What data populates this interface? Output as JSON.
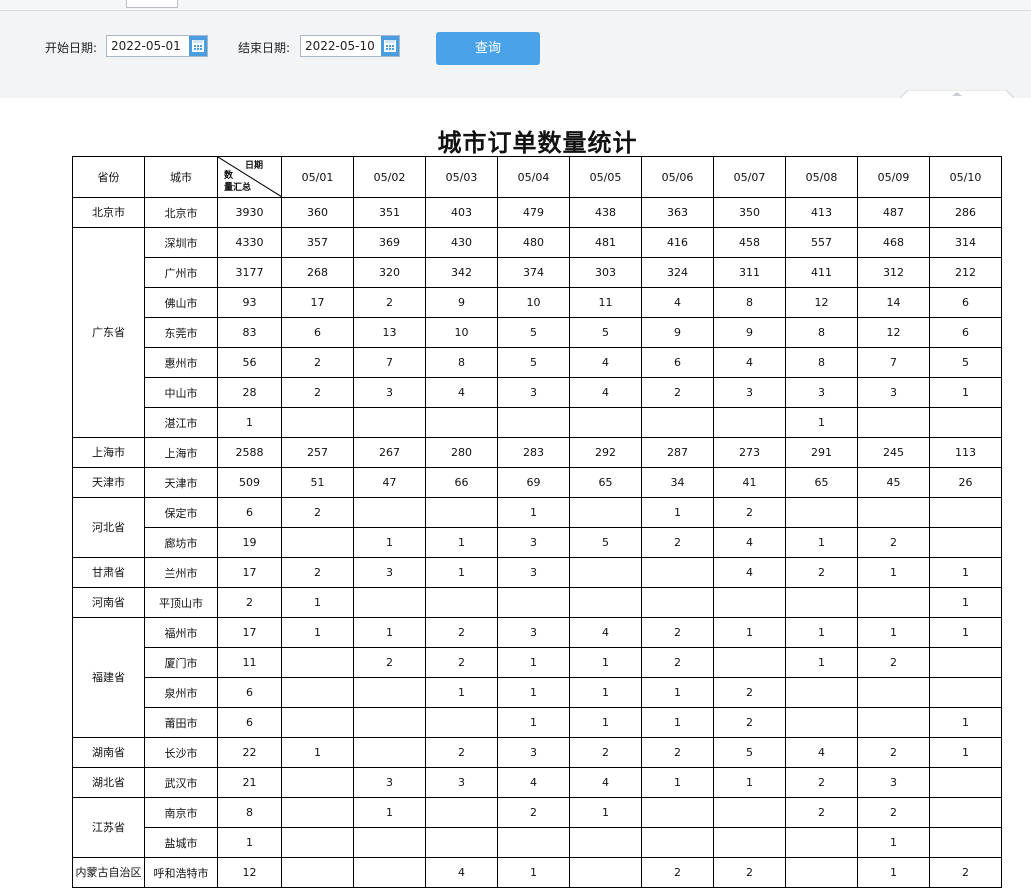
{
  "filters": {
    "start_label": "开始日期:",
    "start_value": "2022-05-01",
    "end_label": "结束日期:",
    "end_value": "2022-05-10",
    "query_label": "查询"
  },
  "report": {
    "title": "城市订单数量统计",
    "headers": {
      "province": "省份",
      "city": "城市",
      "diag_top": "日期",
      "diag_bottom": "数\n量汇总",
      "dates": [
        "05/01",
        "05/02",
        "05/03",
        "05/04",
        "05/05",
        "05/06",
        "05/07",
        "05/08",
        "05/09",
        "05/10"
      ]
    },
    "groups": [
      {
        "province": "北京市",
        "rows": [
          {
            "city": "北京市",
            "total": "3930",
            "values": [
              "360",
              "351",
              "403",
              "479",
              "438",
              "363",
              "350",
              "413",
              "487",
              "286"
            ]
          }
        ]
      },
      {
        "province": "广东省",
        "rows": [
          {
            "city": "深圳市",
            "total": "4330",
            "values": [
              "357",
              "369",
              "430",
              "480",
              "481",
              "416",
              "458",
              "557",
              "468",
              "314"
            ]
          },
          {
            "city": "广州市",
            "total": "3177",
            "values": [
              "268",
              "320",
              "342",
              "374",
              "303",
              "324",
              "311",
              "411",
              "312",
              "212"
            ]
          },
          {
            "city": "佛山市",
            "total": "93",
            "values": [
              "17",
              "2",
              "9",
              "10",
              "11",
              "4",
              "8",
              "12",
              "14",
              "6"
            ]
          },
          {
            "city": "东莞市",
            "total": "83",
            "values": [
              "6",
              "13",
              "10",
              "5",
              "5",
              "9",
              "9",
              "8",
              "12",
              "6"
            ]
          },
          {
            "city": "惠州市",
            "total": "56",
            "values": [
              "2",
              "7",
              "8",
              "5",
              "4",
              "6",
              "4",
              "8",
              "7",
              "5"
            ]
          },
          {
            "city": "中山市",
            "total": "28",
            "values": [
              "2",
              "3",
              "4",
              "3",
              "4",
              "2",
              "3",
              "3",
              "3",
              "1"
            ]
          },
          {
            "city": "湛江市",
            "total": "1",
            "values": [
              "",
              "",
              "",
              "",
              "",
              "",
              "",
              "1",
              "",
              ""
            ]
          }
        ]
      },
      {
        "province": "上海市",
        "rows": [
          {
            "city": "上海市",
            "total": "2588",
            "values": [
              "257",
              "267",
              "280",
              "283",
              "292",
              "287",
              "273",
              "291",
              "245",
              "113"
            ]
          }
        ]
      },
      {
        "province": "天津市",
        "rows": [
          {
            "city": "天津市",
            "total": "509",
            "values": [
              "51",
              "47",
              "66",
              "69",
              "65",
              "34",
              "41",
              "65",
              "45",
              "26"
            ]
          }
        ]
      },
      {
        "province": "河北省",
        "rows": [
          {
            "city": "保定市",
            "total": "6",
            "values": [
              "2",
              "",
              "",
              "1",
              "",
              "1",
              "2",
              "",
              "",
              ""
            ]
          },
          {
            "city": "廊坊市",
            "total": "19",
            "values": [
              "",
              "1",
              "1",
              "3",
              "5",
              "2",
              "4",
              "1",
              "2",
              ""
            ]
          }
        ]
      },
      {
        "province": "甘肃省",
        "rows": [
          {
            "city": "兰州市",
            "total": "17",
            "values": [
              "2",
              "3",
              "1",
              "3",
              "",
              "",
              "4",
              "2",
              "1",
              "1"
            ]
          }
        ]
      },
      {
        "province": "河南省",
        "rows": [
          {
            "city": "平顶山市",
            "total": "2",
            "values": [
              "1",
              "",
              "",
              "",
              "",
              "",
              "",
              "",
              "",
              "1"
            ]
          }
        ]
      },
      {
        "province": "福建省",
        "rows": [
          {
            "city": "福州市",
            "total": "17",
            "values": [
              "1",
              "1",
              "2",
              "3",
              "4",
              "2",
              "1",
              "1",
              "1",
              "1"
            ]
          },
          {
            "city": "厦门市",
            "total": "11",
            "values": [
              "",
              "2",
              "2",
              "1",
              "1",
              "2",
              "",
              "1",
              "2",
              ""
            ]
          },
          {
            "city": "泉州市",
            "total": "6",
            "values": [
              "",
              "",
              "1",
              "1",
              "1",
              "1",
              "2",
              "",
              "",
              ""
            ]
          },
          {
            "city": "莆田市",
            "total": "6",
            "values": [
              "",
              "",
              "",
              "1",
              "1",
              "1",
              "2",
              "",
              "",
              "1"
            ]
          }
        ]
      },
      {
        "province": "湖南省",
        "rows": [
          {
            "city": "长沙市",
            "total": "22",
            "values": [
              "1",
              "",
              "2",
              "3",
              "2",
              "2",
              "5",
              "4",
              "2",
              "1"
            ]
          }
        ]
      },
      {
        "province": "湖北省",
        "rows": [
          {
            "city": "武汉市",
            "total": "21",
            "values": [
              "",
              "3",
              "3",
              "4",
              "4",
              "1",
              "1",
              "2",
              "3",
              ""
            ]
          }
        ]
      },
      {
        "province": "江苏省",
        "rows": [
          {
            "city": "南京市",
            "total": "8",
            "values": [
              "",
              "1",
              "",
              "2",
              "1",
              "",
              "",
              "2",
              "2",
              ""
            ]
          },
          {
            "city": "盐城市",
            "total": "1",
            "values": [
              "",
              "",
              "",
              "",
              "",
              "",
              "",
              "",
              "1",
              ""
            ]
          }
        ]
      },
      {
        "province": "内蒙古自治区",
        "rows": [
          {
            "city": "呼和浩特市",
            "total": "12",
            "values": [
              "",
              "",
              "4",
              "1",
              "",
              "2",
              "2",
              "",
              "1",
              "2"
            ]
          }
        ]
      }
    ]
  }
}
